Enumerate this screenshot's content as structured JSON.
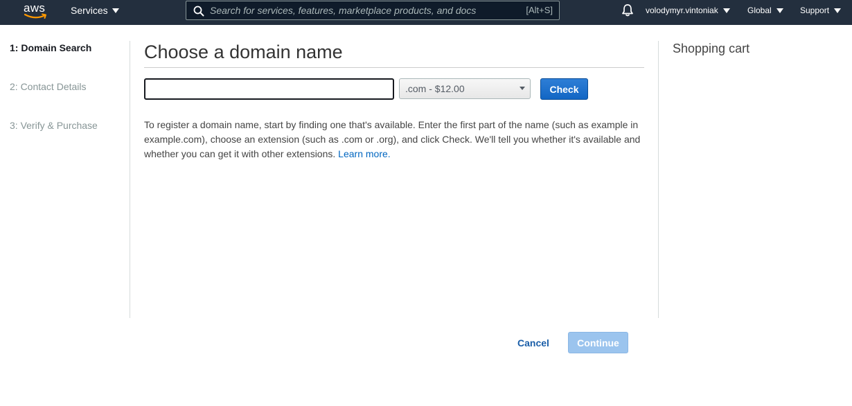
{
  "header": {
    "logo_text": "aws",
    "services_label": "Services",
    "search_placeholder": "Search for services, features, marketplace products, and docs",
    "search_shortcut": "[Alt+S]",
    "username": "volodymyr.vintoniak",
    "region": "Global",
    "support": "Support"
  },
  "steps": [
    {
      "label": "1: Domain Search",
      "active": true
    },
    {
      "label": "2: Contact Details",
      "active": false
    },
    {
      "label": "3: Verify & Purchase",
      "active": false
    }
  ],
  "main": {
    "title": "Choose a domain name",
    "domain_input_value": "",
    "tld_selected": ".com - $12.00",
    "check_label": "Check",
    "description": "To register a domain name, start by finding one that's available. Enter the first part of the name (such as example in example.com), choose an extension (such as .com or .org), and click Check. We'll tell you whether it's available and whether you can get it with other extensions.",
    "learn_more": "Learn more."
  },
  "cart": {
    "title": "Shopping cart"
  },
  "footer": {
    "cancel_label": "Cancel",
    "continue_label": "Continue",
    "continue_enabled": false
  },
  "colors": {
    "nav_bg": "#232f3e",
    "primary_button": "#1266c4",
    "disabled_button": "#9bc4ee",
    "link": "#0066c0",
    "logo_smile": "#ff9900"
  }
}
